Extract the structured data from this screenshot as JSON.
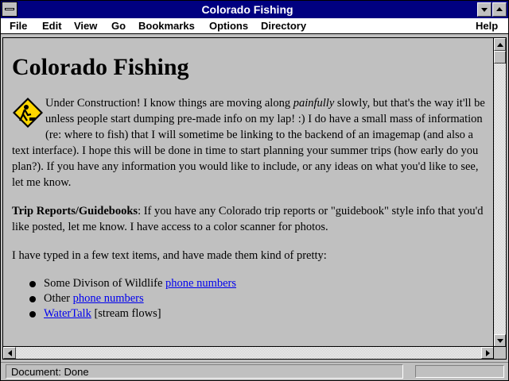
{
  "window": {
    "title": "Colorado Fishing"
  },
  "menu": {
    "file": "File",
    "edit": "Edit",
    "view": "View",
    "go": "Go",
    "bookmarks": "Bookmarks",
    "options": "Options",
    "directory": "Directory",
    "help": "Help"
  },
  "page": {
    "heading": "Colorado Fishing",
    "construction": {
      "intro": "Under Construction! I know things are moving along ",
      "emph": "painfully",
      "rest": " slowly, but that's the way it'll be unless people start dumping pre-made info on my lap! :) I do have a small mass of information (re: where to fish) that I will sometime be linking to the backend of an imagemap (and also a text interface). I hope this will be done in time to start planning your summer trips (how early do you plan?). If you have any information you would like to include, or any ideas on what you'd like to see, let me know."
    },
    "trip": {
      "label": "Trip Reports/Guidebooks",
      "text": ": If you have any Colorado trip reports or \"guidebook\" style info that you'd like posted, let me know. I have access to a color scanner for photos."
    },
    "typed_intro": "I have typed in a few text items, and have made them kind of pretty:",
    "items": [
      {
        "prefix": "Some Divison of Wildlife ",
        "link": "phone numbers",
        "suffix": ""
      },
      {
        "prefix": "Other ",
        "link": "phone numbers",
        "suffix": ""
      },
      {
        "prefix": "",
        "link": "WaterTalk",
        "suffix": " [stream flows]"
      }
    ]
  },
  "status": {
    "text": "Document: Done"
  },
  "colors": {
    "titlebar": "#000080",
    "chrome": "#c0c0c0",
    "link": "#0000ee"
  },
  "icons": [
    "system-menu-icon",
    "minimize-icon",
    "maximize-icon",
    "under-construction-icon",
    "scroll-up-icon",
    "scroll-down-icon",
    "scroll-left-icon",
    "scroll-right-icon"
  ]
}
